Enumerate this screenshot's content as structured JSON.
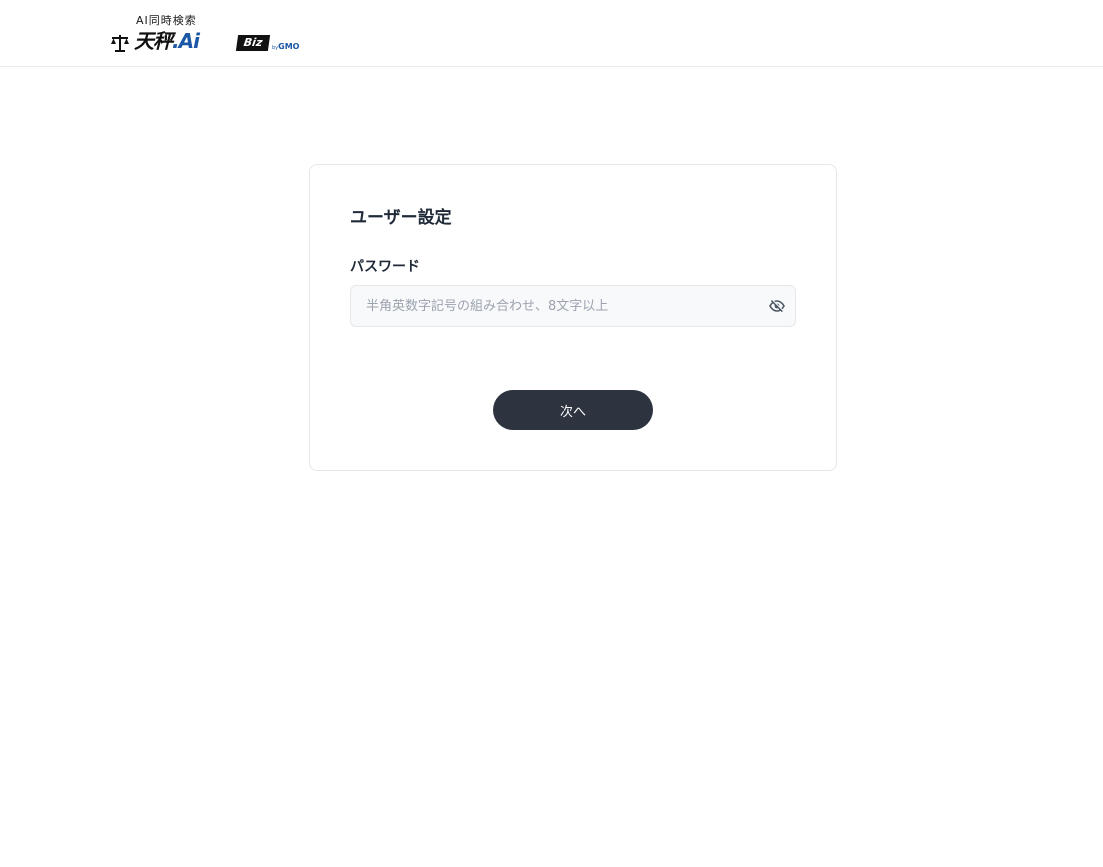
{
  "header": {
    "logo": {
      "tagline": "AI同時検索",
      "main_text": "天秤",
      "dot_ai": ".Ai",
      "biz": "Biz",
      "by": "by",
      "gmo": "GMO"
    }
  },
  "form": {
    "title": "ユーザー設定",
    "password_label": "パスワード",
    "password_placeholder": "半角英数字記号の組み合わせ、8文字以上",
    "password_value": "",
    "eye_icon": "eye-off-icon",
    "next_button_label": "次へ"
  },
  "colors": {
    "button_bg": "#2d3440",
    "brand_blue": "#1b57a6",
    "input_bg": "#f8f9fa",
    "border": "#e5e7eb"
  }
}
